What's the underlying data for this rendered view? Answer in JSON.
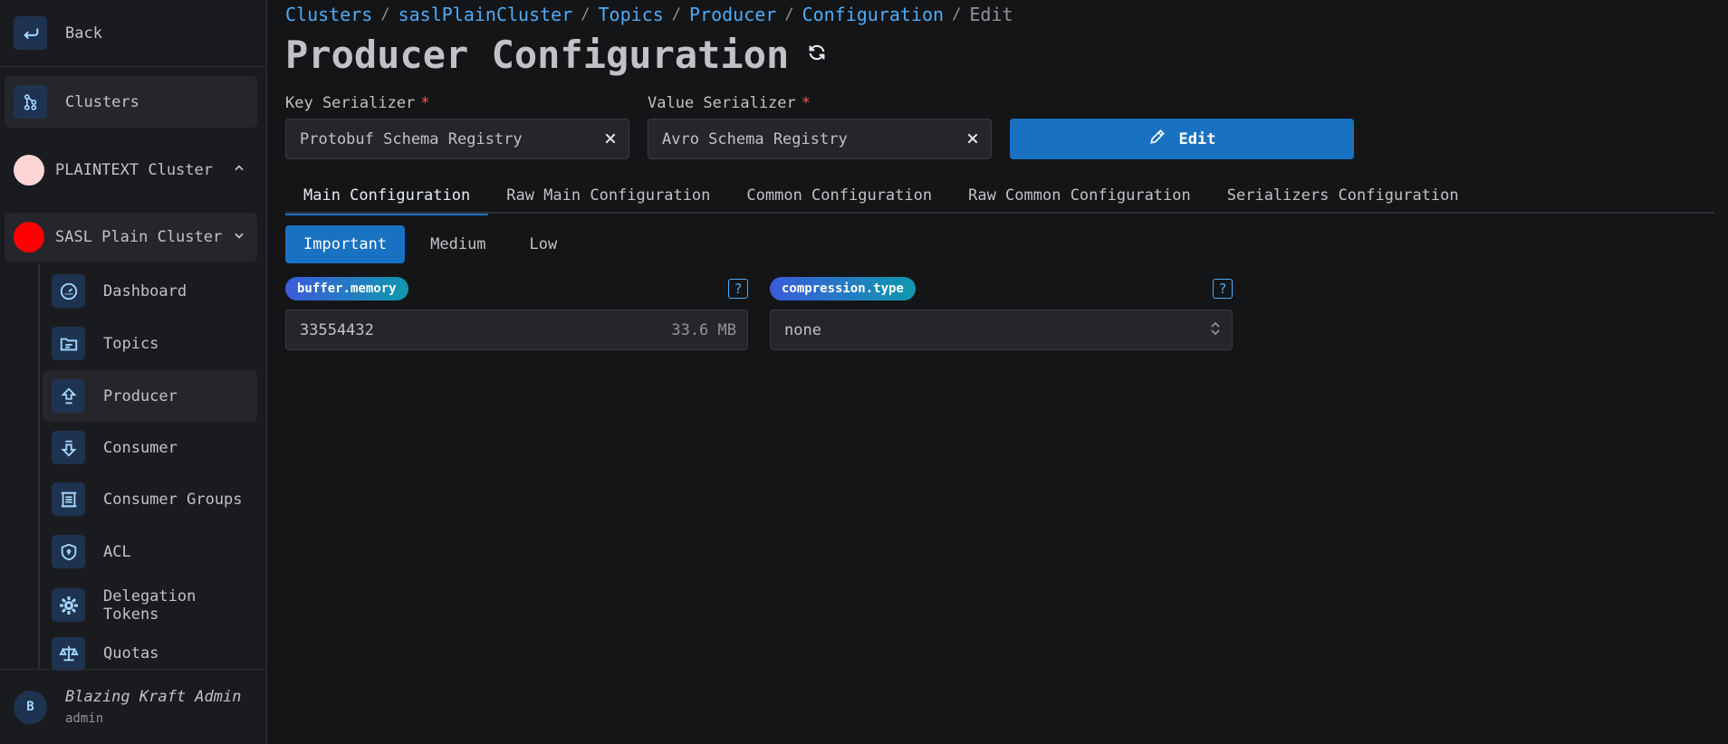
{
  "sidebar": {
    "back_label": "Back",
    "clusters_label": "Clusters",
    "clusters_list": [
      {
        "name": "PLAINTEXT Cluster",
        "color": "#ffd6d6"
      },
      {
        "name": "SASL Plain Cluster",
        "color": "#ff0000"
      }
    ],
    "nav_items": [
      {
        "label": "Dashboard",
        "icon": "gauge-icon"
      },
      {
        "label": "Topics",
        "icon": "folder-icon"
      },
      {
        "label": "Producer",
        "icon": "upload-arrow-icon"
      },
      {
        "label": "Consumer",
        "icon": "download-arrow-icon"
      },
      {
        "label": "Consumer Groups",
        "icon": "group-icon"
      },
      {
        "label": "ACL",
        "icon": "shield-icon"
      },
      {
        "label": "Delegation Tokens",
        "icon": "gear-icon"
      },
      {
        "label": "Quotas",
        "icon": "scale-icon"
      }
    ],
    "user": {
      "initial": "B",
      "name": "Blazing Kraft Admin",
      "role": "admin"
    }
  },
  "breadcrumb": {
    "items": [
      "Clusters",
      "saslPlainCluster",
      "Topics",
      "Producer",
      "Configuration"
    ],
    "current": "Edit"
  },
  "page_title": "Producer Configuration",
  "key_serializer": {
    "label": "Key Serializer",
    "required_mark": "*",
    "value": "Protobuf Schema Registry"
  },
  "value_serializer": {
    "label": "Value Serializer",
    "required_mark": "*",
    "value": "Avro Schema Registry"
  },
  "edit_label": "Edit",
  "tabs": [
    "Main Configuration",
    "Raw Main Configuration",
    "Common Configuration",
    "Raw Common Configuration",
    "Serializers Configuration"
  ],
  "levels": [
    "Important",
    "Medium",
    "Low"
  ],
  "configs": [
    {
      "key": "buffer.memory",
      "value": "33554432",
      "hint": "33.6 MB",
      "help": "?"
    },
    {
      "key": "compression.type",
      "value": "none",
      "hint": "",
      "help": "?"
    }
  ],
  "colors": {
    "accent": "#1971c2",
    "link": "#4dabf7",
    "required": "#fa5252"
  }
}
